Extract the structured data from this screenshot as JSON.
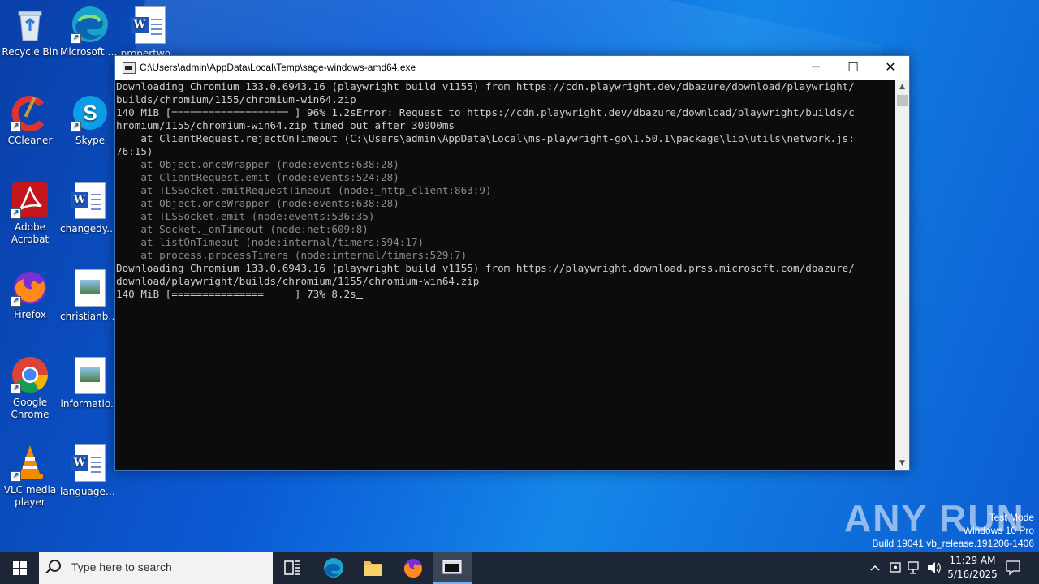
{
  "desktop": {
    "icons": [
      {
        "label": "Recycle Bin"
      },
      {
        "label": "Microsoft Edge"
      },
      {
        "label": "propertwo..."
      },
      {
        "label": "CCleaner"
      },
      {
        "label": "Skype"
      },
      {
        "label": "Adobe Acrobat"
      },
      {
        "label": "changedy.rtf"
      },
      {
        "label": "Firefox"
      },
      {
        "label": "christianby..."
      },
      {
        "label": "Google Chrome"
      },
      {
        "label": "informatio..."
      },
      {
        "label": "VLC media player"
      },
      {
        "label": "languagem..."
      }
    ]
  },
  "window": {
    "title": "C:\\Users\\admin\\AppData\\Local\\Temp\\sage-windows-amd64.exe",
    "minimize": "─",
    "maximize": "☐",
    "close": "✕",
    "console_lines": [
      "Downloading Chromium 133.0.6943.16 (playwright build v1155) from https://cdn.playwright.dev/dbazure/download/playwright/",
      "builds/chromium/1155/chromium-win64.zip",
      "140 MiB [=================== ] 96% 1.2sError: Request to https://cdn.playwright.dev/dbazure/download/playwright/builds/c",
      "hromium/1155/chromium-win64.zip timed out after 30000ms",
      "    at ClientRequest.rejectOnTimeout (C:\\Users\\admin\\AppData\\Local\\ms-playwright-go\\1.50.1\\package\\lib\\utils\\network.js:",
      "76:15)",
      "    at Object.onceWrapper (node:events:638:28)",
      "    at ClientRequest.emit (node:events:524:28)",
      "    at TLSSocket.emitRequestTimeout (node:_http_client:863:9)",
      "    at Object.onceWrapper (node:events:638:28)",
      "    at TLSSocket.emit (node:events:536:35)",
      "    at Socket._onTimeout (node:net:609:8)",
      "    at listOnTimeout (node:internal/timers:594:17)",
      "    at process.processTimers (node:internal/timers:529:7)",
      "Downloading Chromium 133.0.6943.16 (playwright build v1155) from https://playwright.download.prss.microsoft.com/dbazure/",
      "download/playwright/builds/chromium/1155/chromium-win64.zip",
      "140 MiB [===============     ] 73% 8.2s"
    ]
  },
  "watermark": {
    "brand": "ANY RUN",
    "line1": "Test Mode",
    "line2": "Windows 10 Pro",
    "line3": "Build 19041.vb_release.191206-1406"
  },
  "taskbar": {
    "search_placeholder": "Type here to search",
    "time": "11:29 AM",
    "date": "5/16/2025"
  }
}
